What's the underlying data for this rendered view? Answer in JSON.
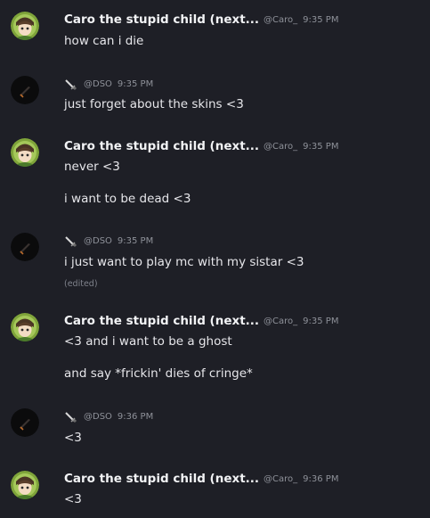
{
  "messages": [
    {
      "author": "Caro the stupid child (next...",
      "handle": "@Caro_",
      "time": "9:35 PM",
      "lines": [
        "how can i die"
      ]
    },
    {
      "author": "",
      "handle": "@DSO",
      "time": "9:35 PM",
      "lines": [
        "just forget about the skins <3"
      ]
    },
    {
      "author": "Caro the stupid child (next...",
      "handle": "@Caro_",
      "time": "9:35 PM",
      "lines": [
        "never <3",
        "i want to be dead <3"
      ]
    },
    {
      "author": "",
      "handle": "@DSO",
      "time": "9:35 PM",
      "lines": [
        "i just want to play mc with my sistar <3"
      ],
      "edited": "(edited)"
    },
    {
      "author": "Caro the stupid child (next...",
      "handle": "@Caro_",
      "time": "9:35 PM",
      "lines": [
        "<3 and i want to be a ghost",
        "and say *frickin' dies of cringe*"
      ]
    },
    {
      "author": "",
      "handle": "@DSO",
      "time": "9:36 PM",
      "lines": [
        "<3"
      ]
    },
    {
      "author": "Caro the stupid child (next...",
      "handle": "@Caro_",
      "time": "9:36 PM",
      "lines": [
        "<3"
      ]
    }
  ],
  "colors": {
    "background": "#1e1f26",
    "name": "#f2f3f5",
    "meta": "#8e9199",
    "text": "#e6e6ea"
  },
  "icons": {
    "caro_avatar": "anime-girl-avatar-icon",
    "dso_avatar": "dark-sword-avatar-icon",
    "dso_badge": "sword-icon"
  }
}
